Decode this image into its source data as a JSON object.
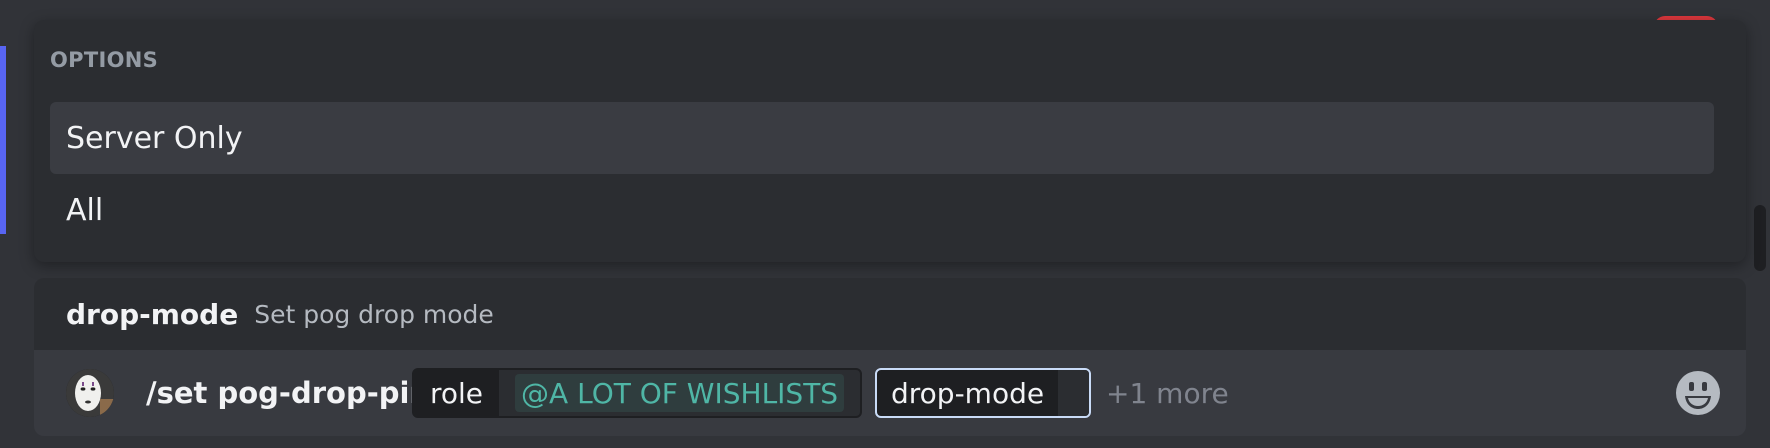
{
  "colors": {
    "accent": "#5865f2",
    "mention_text": "#4fb6a6",
    "focus_border": "#c9dbf7",
    "danger": "#da373c"
  },
  "options_popup": {
    "header": "OPTIONS",
    "items": [
      {
        "label": "Server Only",
        "selected": true
      },
      {
        "label": "All",
        "selected": false
      }
    ]
  },
  "command_hint": {
    "name": "drop-mode",
    "description": "Set pog drop mode"
  },
  "composer": {
    "avatar_icon": "user-avatar",
    "command": "/set pog-drop-ping",
    "params": [
      {
        "name": "role",
        "value": "@A LOT OF WISHLISTS"
      },
      {
        "name": "drop-mode",
        "value": ""
      }
    ],
    "more": "+1 more",
    "emoji_icon": "smiley-emoji-icon"
  }
}
